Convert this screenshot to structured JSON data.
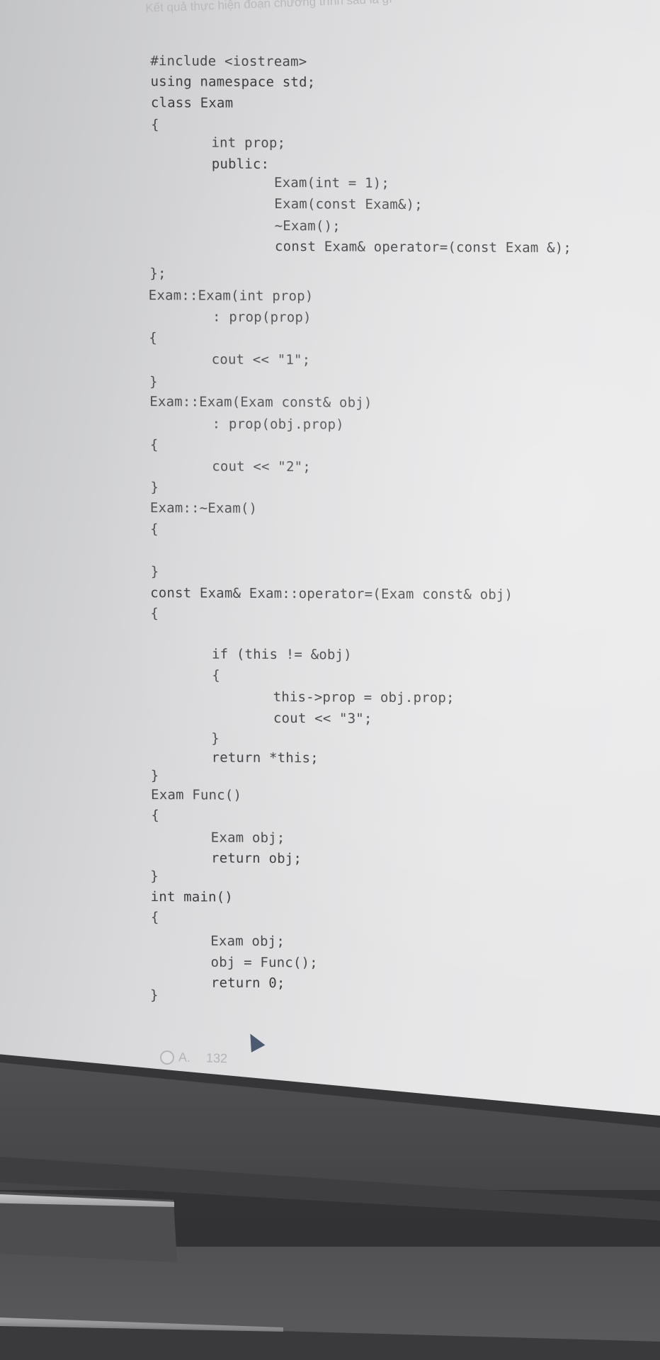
{
  "question_title": "Kết quả thực hiện đoạn chương trình sau là gì",
  "code_lines": [
    "#include <iostream>",
    "using namespace std;",
    "class Exam",
    "{",
    "int prop;",
    "public:",
    "Exam(int = 1);",
    "Exam(const Exam&);",
    "~Exam();",
    "const Exam& operator=(const Exam &);",
    "};",
    "Exam::Exam(int prop)",
    ": prop(prop)",
    "{",
    "cout << \"1\";",
    "}",
    "Exam::Exam(Exam const& obj)",
    ": prop(obj.prop)",
    "{",
    "cout << \"2\";",
    "}",
    "Exam::~Exam()",
    "{",
    "}",
    "const Exam& Exam::operator=(Exam const& obj)",
    "{",
    "if (this != &obj)",
    "{",
    "this->prop = obj.prop;",
    "cout << \"3\";",
    "}",
    "return *this;",
    "}",
    "Exam Func()",
    "{",
    "Exam obj;",
    "return obj;",
    "}",
    "int main()",
    "{",
    "Exam obj;",
    "obj = Func();",
    "return 0;",
    "}"
  ],
  "answer_option": {
    "letter": "A.",
    "value": "132"
  },
  "colors": {
    "screen": "#e3e3e4",
    "code_text": "#4a4a4e",
    "bezel": "#474749"
  }
}
